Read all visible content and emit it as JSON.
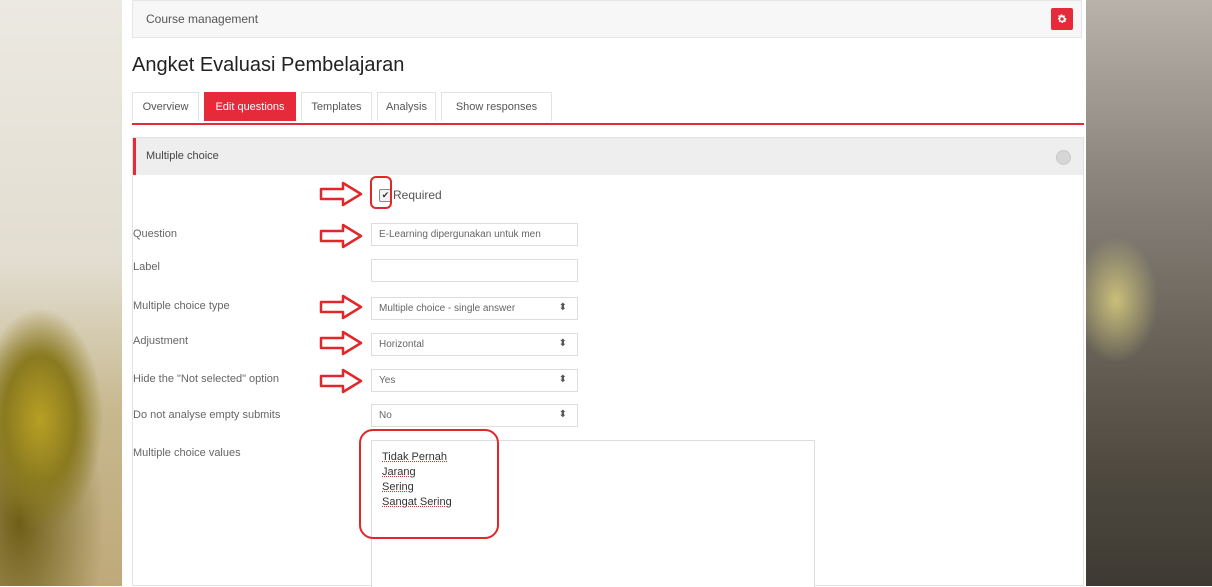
{
  "breadcrumb": "Course management",
  "page_title": "Angket Evaluasi Pembelajaran",
  "tabs": [
    {
      "label": "Overview"
    },
    {
      "label": "Edit questions"
    },
    {
      "label": "Templates"
    },
    {
      "label": "Analysis"
    },
    {
      "label": "Show responses"
    }
  ],
  "active_tab": "Edit questions",
  "section": {
    "title": "Multiple choice",
    "required_label": "Required",
    "required_checked": true
  },
  "fields": {
    "question_label": "Question",
    "question_value": "E-Learning dipergunakan untuk men",
    "label_label": "Label",
    "label_value": "",
    "mc_type_label": "Multiple choice type",
    "mc_type_value": "Multiple choice - single answer",
    "adjustment_label": "Adjustment",
    "adjustment_value": "Horizontal",
    "hide_not_selected_label": "Hide the \"Not selected\" option",
    "hide_not_selected_value": "Yes",
    "no_analyse_label": "Do not analyse empty submits",
    "no_analyse_value": "No",
    "mc_values_label": "Multiple choice values",
    "mc_values": [
      "Tidak Pernah",
      "Jarang",
      "Sering",
      "Sangat Sering"
    ]
  },
  "colors": {
    "accent": "#e52a3a",
    "annotation": "#e2272a"
  },
  "icons": {
    "gear": "gear-icon",
    "collapse": "collapse-icon",
    "caret": "select-caret-icon"
  }
}
